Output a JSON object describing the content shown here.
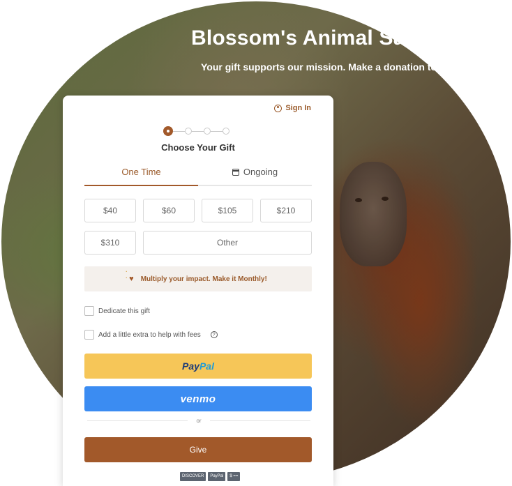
{
  "hero": {
    "title": "Blossom's Animal Sanctuary",
    "subtitle": "Your gift supports our mission. Make a donation today."
  },
  "header": {
    "signin_label": "Sign In",
    "signin_icon": "user-circle-icon"
  },
  "steps": {
    "title": "Choose Your Gift",
    "count": 4,
    "current": 1
  },
  "tabs": [
    {
      "label": "One Time",
      "active": true
    },
    {
      "label": "Ongoing",
      "active": false,
      "icon": "calendar-icon"
    }
  ],
  "amounts": {
    "row1": [
      "$40",
      "$60",
      "$105",
      "$210"
    ],
    "row2": [
      "$310"
    ],
    "other_label": "Other"
  },
  "impact_banner": {
    "text": "Multiply your impact. Make it Monthly!",
    "icon": "heart-icon"
  },
  "options": {
    "dedicate_label": "Dedicate this gift",
    "fees_label": "Add a little extra to help with fees",
    "help_icon": "?"
  },
  "payments": {
    "paypal_part1": "Pay",
    "paypal_part2": "Pal",
    "venmo_label": "venmo",
    "divider_text": "or",
    "give_label": "Give"
  },
  "badges": [
    "DISCOVER",
    "PayPal",
    "$ =="
  ],
  "colors": {
    "accent": "#a2592a",
    "paypal": "#f6c658",
    "venmo": "#3b8cf2"
  }
}
